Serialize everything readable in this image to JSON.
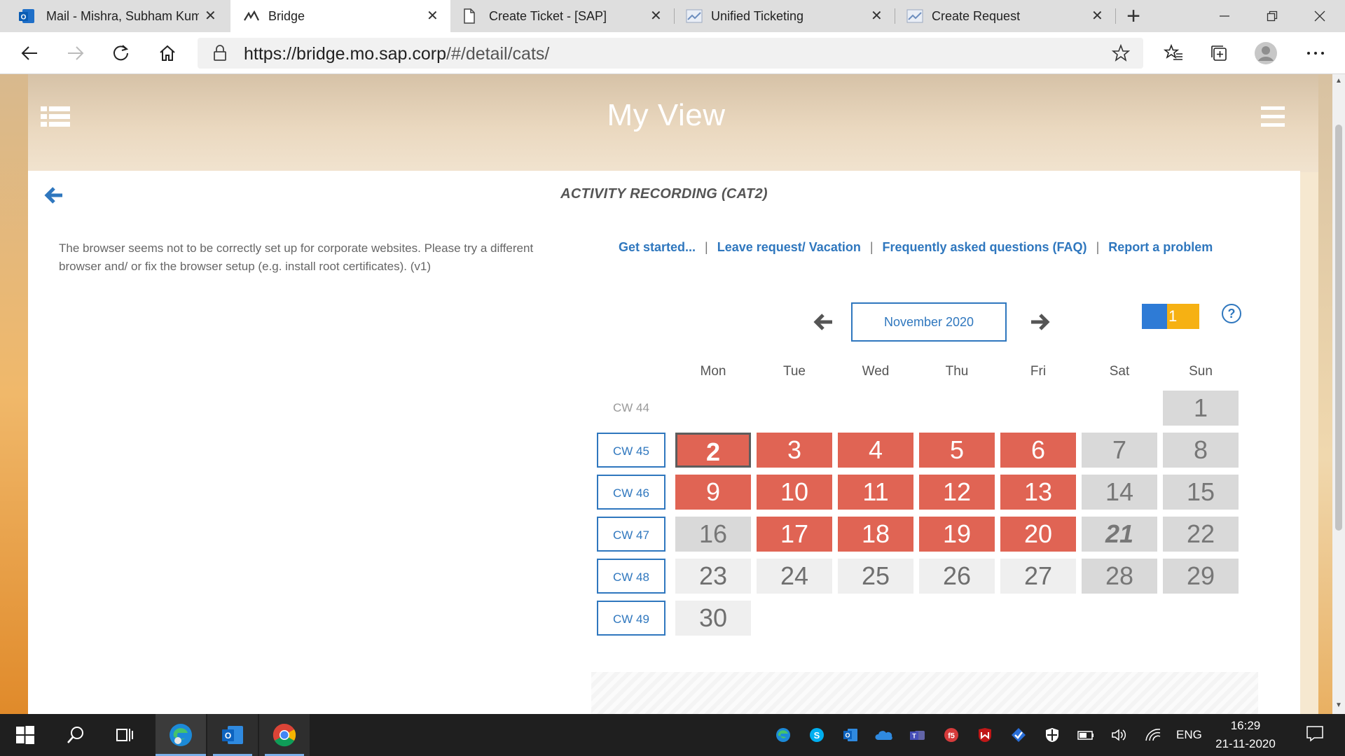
{
  "browser": {
    "tabs": [
      {
        "title": "Mail - Mishra, Subham Kum",
        "icon": "outlook-icon",
        "active": false
      },
      {
        "title": "Bridge",
        "icon": "bridge-icon",
        "active": true
      },
      {
        "title": "Create Ticket - [SAP]",
        "icon": "page-icon",
        "active": false
      },
      {
        "title": "Unified Ticketing",
        "icon": "document-icon",
        "active": false
      },
      {
        "title": "Create Request",
        "icon": "document-icon",
        "active": false
      }
    ],
    "close_glyph": "✕",
    "new_tab_glyph": "+",
    "url_host": "https://bridge.mo.sap.corp",
    "url_path": "/#/detail/cats/"
  },
  "app": {
    "title": "My View",
    "section_title": "ACTIVITY RECORDING (CAT2)",
    "warning": "The browser seems not to be correctly set up for corporate websites. Please try a different browser and/ or fix the browser setup (e.g. install root certificates). (v1)",
    "links": [
      {
        "label": "Get started..."
      },
      {
        "label": "Leave request/ Vacation"
      },
      {
        "label": "Frequently asked questions (FAQ)"
      },
      {
        "label": "Report a problem"
      }
    ],
    "link_separator": "|",
    "legend_value": "1",
    "help_glyph": "?"
  },
  "calendar": {
    "month": "November 2020",
    "weekdays": [
      "Mon",
      "Tue",
      "Wed",
      "Thu",
      "Fri",
      "Sat",
      "Sun"
    ],
    "weeks": [
      {
        "cw": "CW 44",
        "clickable": false,
        "days": [
          null,
          null,
          null,
          null,
          null,
          null,
          {
            "day": "1",
            "status": "weekend"
          }
        ]
      },
      {
        "cw": "CW 45",
        "clickable": true,
        "days": [
          {
            "day": "2",
            "status": "missing",
            "selected": true
          },
          {
            "day": "3",
            "status": "missing"
          },
          {
            "day": "4",
            "status": "missing"
          },
          {
            "day": "5",
            "status": "missing"
          },
          {
            "day": "6",
            "status": "missing"
          },
          {
            "day": "7",
            "status": "weekend"
          },
          {
            "day": "8",
            "status": "weekend"
          }
        ]
      },
      {
        "cw": "CW 46",
        "clickable": true,
        "days": [
          {
            "day": "9",
            "status": "missing"
          },
          {
            "day": "10",
            "status": "missing"
          },
          {
            "day": "11",
            "status": "missing"
          },
          {
            "day": "12",
            "status": "missing"
          },
          {
            "day": "13",
            "status": "missing"
          },
          {
            "day": "14",
            "status": "weekend"
          },
          {
            "day": "15",
            "status": "weekend"
          }
        ]
      },
      {
        "cw": "CW 47",
        "clickable": true,
        "days": [
          {
            "day": "16",
            "status": "weekend"
          },
          {
            "day": "17",
            "status": "missing"
          },
          {
            "day": "18",
            "status": "missing"
          },
          {
            "day": "19",
            "status": "missing"
          },
          {
            "day": "20",
            "status": "missing"
          },
          {
            "day": "21",
            "status": "today"
          },
          {
            "day": "22",
            "status": "weekend"
          }
        ]
      },
      {
        "cw": "CW 48",
        "clickable": true,
        "days": [
          {
            "day": "23",
            "status": "future"
          },
          {
            "day": "24",
            "status": "future"
          },
          {
            "day": "25",
            "status": "future"
          },
          {
            "day": "26",
            "status": "future"
          },
          {
            "day": "27",
            "status": "future"
          },
          {
            "day": "28",
            "status": "weekend"
          },
          {
            "day": "29",
            "status": "weekend"
          }
        ]
      },
      {
        "cw": "CW 49",
        "clickable": true,
        "days": [
          {
            "day": "30",
            "status": "future"
          },
          null,
          null,
          null,
          null,
          null,
          null
        ]
      }
    ],
    "status_colors": {
      "missing": "#e06454",
      "weekend": "#d9d9d9",
      "future": "#efefef",
      "today": "#d9d9d9"
    }
  },
  "taskbar": {
    "language": "ENG",
    "time": "16:29",
    "date": "21-11-2020"
  }
}
